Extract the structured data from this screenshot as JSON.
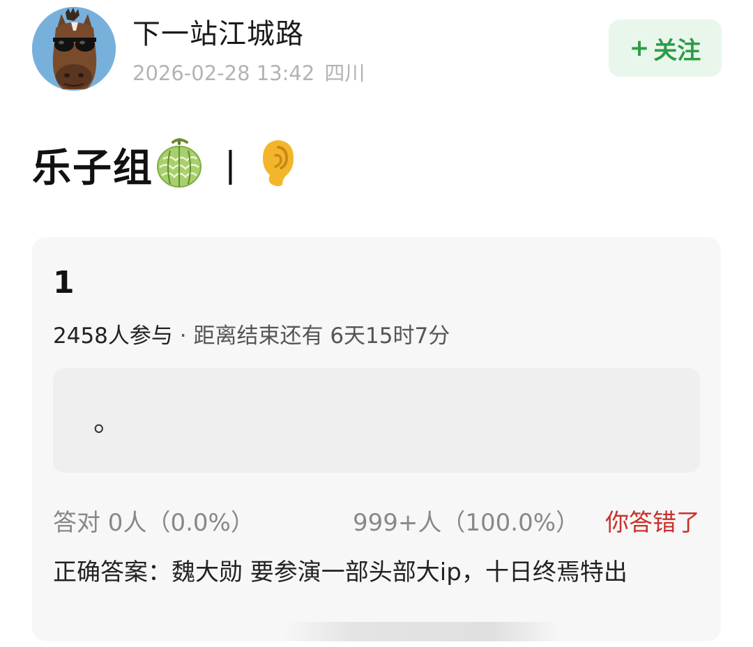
{
  "header": {
    "username": "下一站江城路",
    "datetime": "2026-02-28 13:42",
    "location": "四川",
    "follow_plus": "+",
    "follow_label": "关注",
    "accent_color": "#2c9c48",
    "avatar_icon": "horse-sunglasses-avatar"
  },
  "post": {
    "title": "乐子组",
    "emoji_1": "melon-icon",
    "separator": "|",
    "emoji_2": "ear-icon"
  },
  "quiz": {
    "title": "1",
    "participants": "2458人参与",
    "deadline": " · 距离结束还有 6天15时7分",
    "option_text": "。",
    "correct_stat": "答对  0人（0.0%）",
    "wrong_stat": "999+人（100.0%）",
    "result": "你答错了",
    "result_color": "#c8302c",
    "correct_fraction": 0.0,
    "wrong_fraction": 1.0,
    "answer": "正确答案：魏大勋 要参演一部头部大ip，十日终焉特出"
  }
}
